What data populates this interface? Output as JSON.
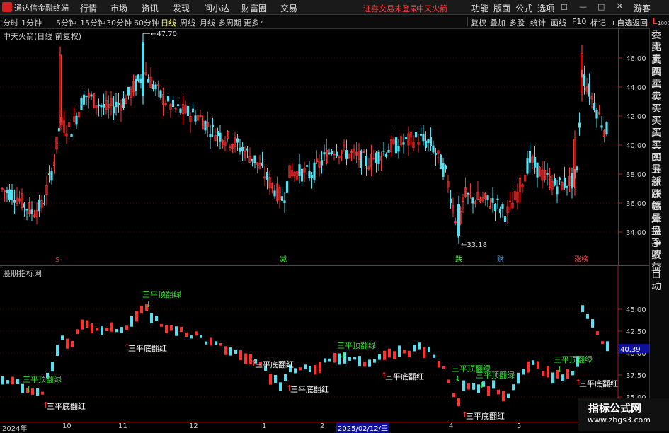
{
  "app": {
    "title": "通达信金融终端"
  },
  "menu": {
    "items": [
      "行情",
      "市场",
      "资讯",
      "发现",
      "问小达",
      "财富圈",
      "交易"
    ],
    "warning": "证券交易未登录",
    "stock": "中天火箭",
    "right": [
      "功能",
      "版面",
      "公式",
      "选项"
    ],
    "guest": "游客"
  },
  "periods": [
    "分时",
    "1分钟",
    "5分钟",
    "15分钟",
    "30分钟",
    "60分钟",
    "日线",
    "周线",
    "月线",
    "多周期",
    "更多"
  ],
  "active_period": "日线",
  "toolbar": [
    "复权",
    "叠加",
    "多股",
    "统计",
    "画线",
    "F10",
    "标记",
    "+自选",
    "返回"
  ],
  "main_chart": {
    "title": "中天火箭(日线 前复权)",
    "high_label": "47.70",
    "low_label": "33.18",
    "y_ticks": [
      "46.00",
      "44.00",
      "42.00",
      "40.00",
      "38.00",
      "36.00",
      "34.00"
    ],
    "markers": [
      "S",
      "减",
      "跌",
      "财",
      "涨榜"
    ]
  },
  "sub_chart": {
    "title": "股朋指标网",
    "y_ticks": [
      "45.00",
      "42.50",
      "40.00",
      "37.50",
      "35.00"
    ],
    "current_value": "40.39",
    "signal_top": "三平顶翻绿",
    "signal_bottom": "三平底翻红"
  },
  "time_axis": [
    "2024年",
    "10",
    "11",
    "12",
    "1",
    "2",
    "2025/02/12/三",
    "3",
    "4",
    "5"
  ],
  "right_panel": [
    "委比",
    "卖五",
    "卖四",
    "卖三",
    "卖二",
    "卖一",
    "买一",
    "买二",
    "买三",
    "买四",
    "买五",
    "最新",
    "涨跌",
    "涨幅",
    "总量",
    "外盘",
    "换手",
    "净资",
    "收益",
    "自动"
  ],
  "right_panel_unit": "1000",
  "watermark": {
    "line1": "指标公式网",
    "line2": "www.zbgs3.com"
  },
  "colors": {
    "up": "#ff3030",
    "down": "#54e0f0",
    "signal_green": "#30e030",
    "signal_red": "#ff3030",
    "axis": "#a02020"
  }
}
